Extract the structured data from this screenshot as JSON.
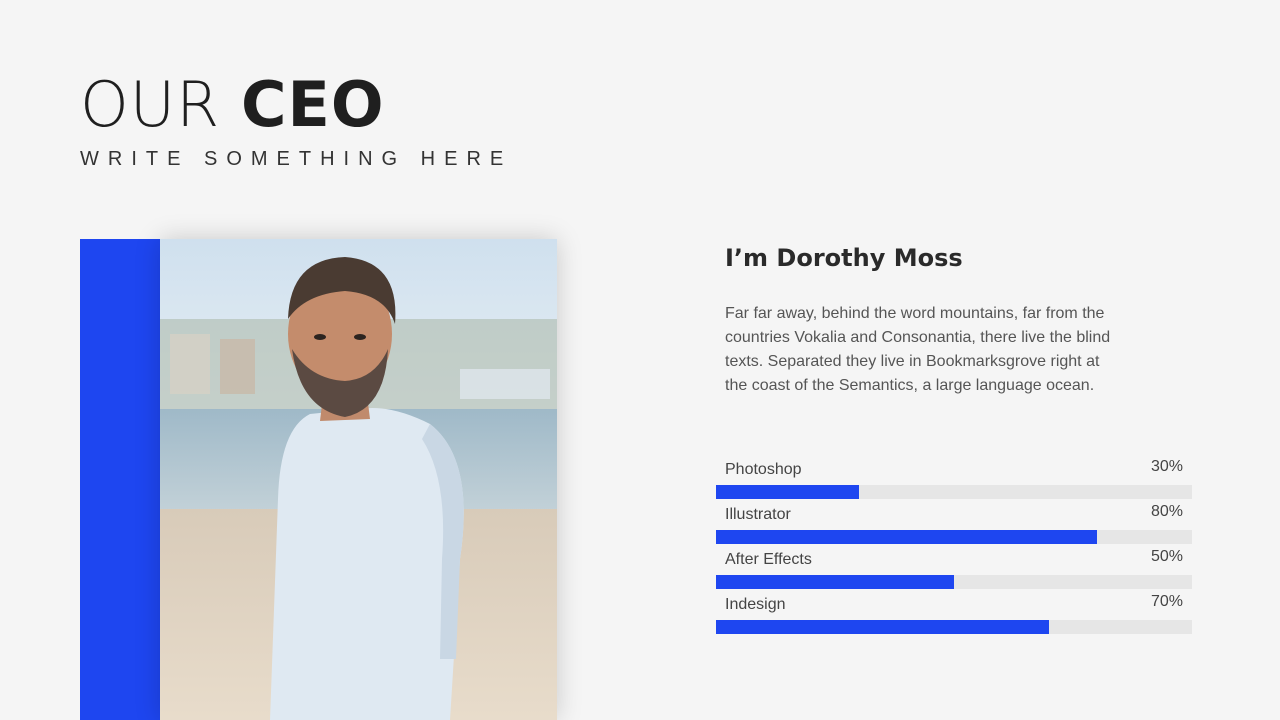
{
  "header": {
    "title_light": "OUR",
    "title_bold": "CEO",
    "subtitle": "WRITE SOMETHING HERE"
  },
  "profile": {
    "name": "I’m Dorothy Moss",
    "bio": "Far far away, behind the word mountains, far from the countries Vokalia and Consonantia, there live the blind texts. Separated they live in Bookmarksgrove right at the coast of the Semantics, a large language ocean."
  },
  "skills": [
    {
      "label": "Photoshop",
      "value_text": "30%",
      "percent": 30
    },
    {
      "label": "Illustrator",
      "value_text": "80%",
      "percent": 80
    },
    {
      "label": "After Effects",
      "value_text": "50%",
      "percent": 50
    },
    {
      "label": "Indesign",
      "value_text": "70%",
      "percent": 70
    }
  ],
  "colors": {
    "accent": "#1e46f0",
    "background": "#f5f5f5",
    "track": "#e6e6e6"
  }
}
